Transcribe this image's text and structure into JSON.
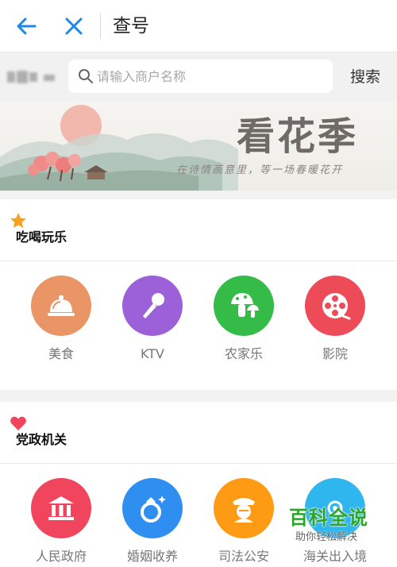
{
  "nav": {
    "title": "查号"
  },
  "search": {
    "placeholder": "请输入商户名称",
    "button_label": "搜索"
  },
  "banner": {
    "title": "看花季",
    "subtitle": "在诗情画意里，等一场春暖花开"
  },
  "sections": [
    {
      "title": "吃喝玩乐",
      "icon": "star-icon",
      "items": [
        {
          "label": "美食",
          "icon": "food-cloche-icon",
          "color": "#e99565"
        },
        {
          "label": "KTV",
          "icon": "microphone-icon",
          "color": "#9c61d8"
        },
        {
          "label": "农家乐",
          "icon": "mushroom-icon",
          "color": "#34bb48"
        },
        {
          "label": "影院",
          "icon": "film-reel-icon",
          "color": "#ee4b59"
        }
      ]
    },
    {
      "title": "党政机关",
      "icon": "heart-icon",
      "items": [
        {
          "label": "人民政府",
          "icon": "government-building-icon",
          "color": "#f0455c"
        },
        {
          "label": "婚姻收养",
          "icon": "ring-icon",
          "color": "#2f8ff0"
        },
        {
          "label": "司法公安",
          "icon": "police-icon",
          "color": "#ff9a14"
        },
        {
          "label": "海关出入境",
          "icon": "customs-icon",
          "color": "#2fb6ef"
        }
      ]
    }
  ],
  "watermark": {
    "title": "百科全说",
    "subtitle": "助你轻松解决"
  },
  "colors": {
    "accent_blue": "#1e88e5",
    "star": "#f7a21c",
    "heart": "#f0455c"
  }
}
